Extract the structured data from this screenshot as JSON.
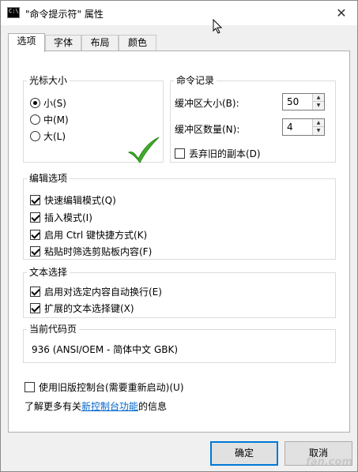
{
  "window": {
    "title": "\"命令提示符\" 属性",
    "close_glyph": "✕"
  },
  "tabs": [
    {
      "label": "选项",
      "active": true
    },
    {
      "label": "字体"
    },
    {
      "label": "布局"
    },
    {
      "label": "颜色"
    }
  ],
  "cursor_size": {
    "label": "光标大小",
    "options": [
      {
        "label": "小(S)",
        "checked": true
      },
      {
        "label": "中(M)",
        "checked": false
      },
      {
        "label": "大(L)",
        "checked": false
      }
    ]
  },
  "history": {
    "label": "命令记录",
    "buffer_size_label": "缓冲区大小(B):",
    "buffer_size_value": "50",
    "buffer_count_label": "缓冲区数量(N):",
    "buffer_count_value": "4",
    "discard_label": "丢弃旧的副本(D)"
  },
  "edit_options": {
    "label": "编辑选项",
    "items": [
      {
        "label": "快速编辑模式(Q)",
        "checked": true
      },
      {
        "label": "插入模式(I)",
        "checked": true
      },
      {
        "label": "启用 Ctrl 键快捷方式(K)",
        "checked": true
      },
      {
        "label": "粘贴时筛选剪贴板内容(F)",
        "checked": true
      }
    ]
  },
  "text_select": {
    "label": "文本选择",
    "items": [
      {
        "label": "启用对选定内容自动换行(E)",
        "checked": true
      },
      {
        "label": "扩展的文本选择键(X)",
        "checked": true
      }
    ]
  },
  "codepage": {
    "label": "当前代码页",
    "value": "936   (ANSI/OEM - 简体中文 GBK)"
  },
  "legacy": {
    "label": "使用旧版控制台(需要重新启动)(U)"
  },
  "learn_more": {
    "prefix": "了解更多有关",
    "link": "新控制台功能",
    "suffix": "的信息"
  },
  "buttons": {
    "ok": "确定",
    "cancel": "取消"
  },
  "watermark": "fan.com",
  "colors": {
    "accent": "#0078d7",
    "checkmark": "#3fae29",
    "link": "#0066cc"
  }
}
